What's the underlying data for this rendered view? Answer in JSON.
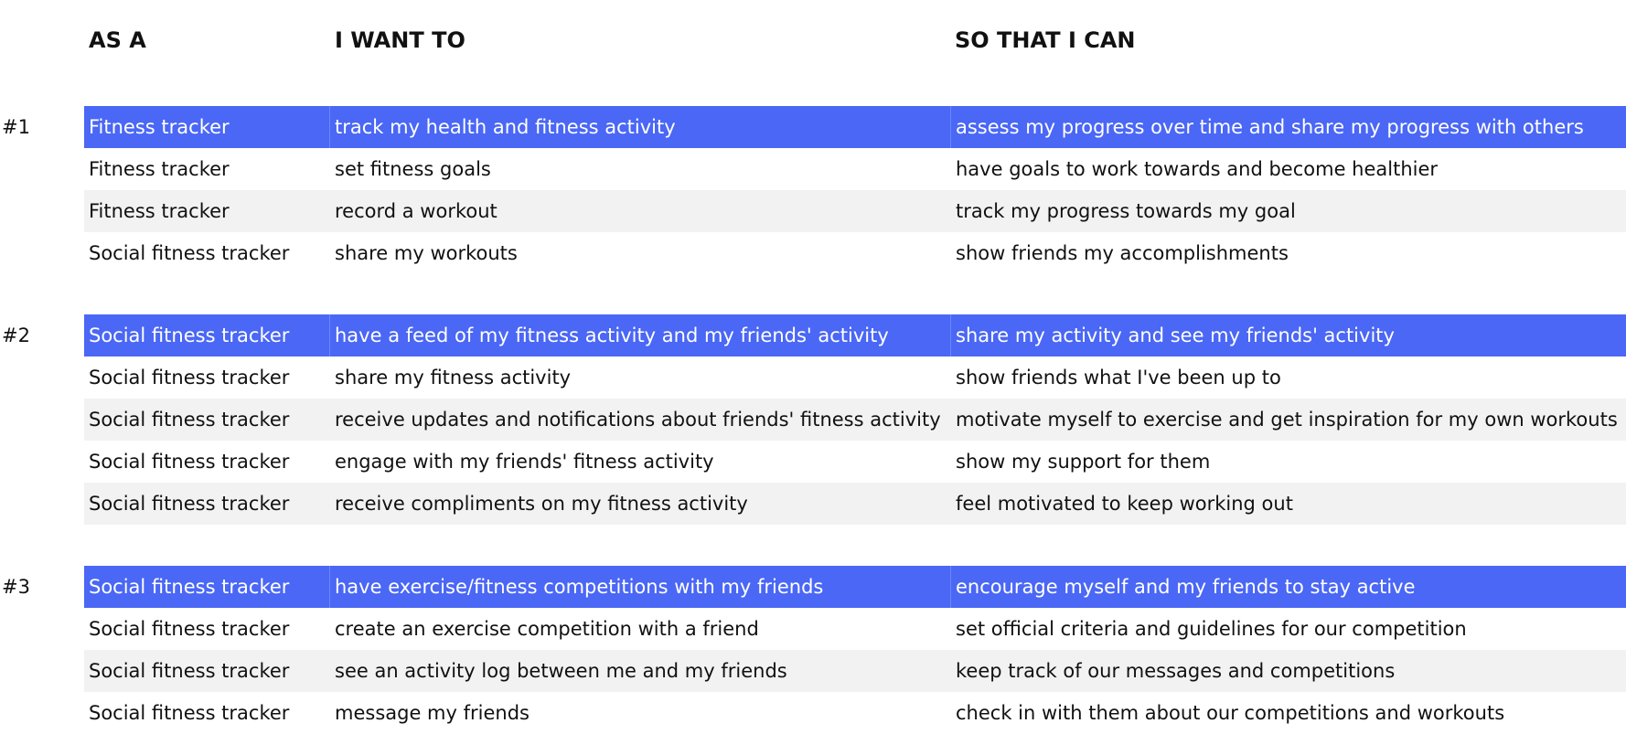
{
  "header": {
    "as_a": "AS A",
    "i_want_to": "I WANT TO",
    "so_that_i_can": "SO THAT I CAN"
  },
  "groups": [
    {
      "number": "#1",
      "rows": [
        {
          "as": "Fitness tracker",
          "want": "track my health and fitness activity",
          "so": "assess my progress over time and share my progress with others"
        },
        {
          "as": "Fitness tracker",
          "want": "set fitness goals",
          "so": "have goals to work towards and become healthier"
        },
        {
          "as": "Fitness tracker",
          "want": "record a workout",
          "so": "track my progress towards my goal"
        },
        {
          "as": "Social fitness tracker",
          "want": "share my workouts",
          "so": "show friends my accomplishments"
        }
      ]
    },
    {
      "number": "#2",
      "rows": [
        {
          "as": "Social fitness tracker",
          "want": "have a feed of my fitness activity and my friends' activity",
          "so": "share my activity and see my friends' activity"
        },
        {
          "as": "Social fitness tracker",
          "want": "share my fitness activity",
          "so": "show friends what I've been up to"
        },
        {
          "as": "Social fitness tracker",
          "want": "receive updates and notifications about friends' fitness activity",
          "so": "motivate myself to exercise and get inspiration for my own workouts"
        },
        {
          "as": "Social fitness tracker",
          "want": "engage with my friends' fitness activity",
          "so": "show my support for them"
        },
        {
          "as": "Social fitness tracker",
          "want": "receive compliments on my fitness activity",
          "so": "feel motivated to keep working out"
        }
      ]
    },
    {
      "number": "#3",
      "rows": [
        {
          "as": "Social fitness tracker",
          "want": "have exercise/fitness competitions with my friends",
          "so": "encourage myself and my friends to stay active"
        },
        {
          "as": "Social fitness tracker",
          "want": "create an exercise competition with a friend",
          "so": "set official criteria and guidelines for our competition"
        },
        {
          "as": "Social fitness tracker",
          "want": "see an activity log between me and my friends",
          "so": "keep track of our messages and competitions"
        },
        {
          "as": "Social fitness tracker",
          "want": "message my friends",
          "so": "check in with them about our competitions and workouts"
        }
      ]
    }
  ],
  "colors": {
    "primary_row": "#4a67f5",
    "alt_row": "#f2f2f2",
    "text": "#111111"
  }
}
